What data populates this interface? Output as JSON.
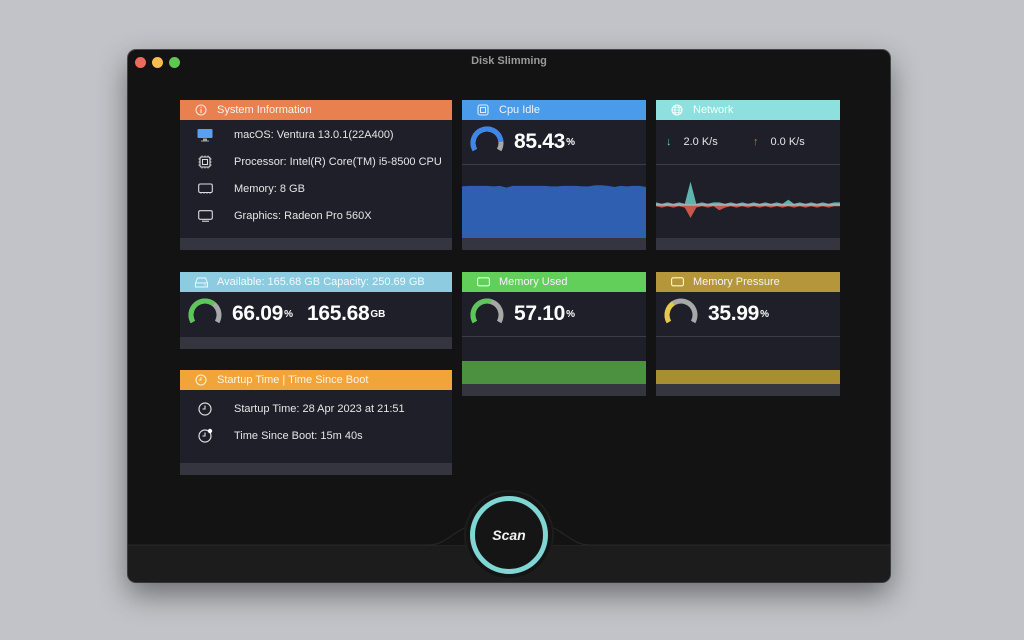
{
  "window": {
    "title": "Disk Slimming"
  },
  "colors": {
    "system_info": "#e8814f",
    "cpu": "#4a9bea",
    "network": "#8de0dd",
    "disk": "#8ccbe0",
    "memory_used": "#62cf5b",
    "memory_pressure": "#b5963a",
    "startup": "#f0a43a",
    "scan_ring": "#7fd6d3"
  },
  "system_info": {
    "title": "System Information",
    "header_icon": "info-icon",
    "rows": [
      {
        "icon": "monitor-icon",
        "text": "macOS: Ventura 13.0.1(22A400)"
      },
      {
        "icon": "cpu-chip-icon",
        "text": "Processor: Intel(R) Core(TM) i5-8500 CPU"
      },
      {
        "icon": "memory-icon",
        "text": "Memory: 8 GB"
      },
      {
        "icon": "display-icon",
        "text": "Graphics: Radeon Pro 560X"
      }
    ]
  },
  "cpu": {
    "title": "Cpu Idle",
    "header_icon": "cpu-chip-icon",
    "value": "85.43",
    "unit": "%",
    "gauge_fraction": 0.8543,
    "history_percent": [
      84,
      85,
      85,
      85,
      85,
      84,
      85,
      82,
      85,
      85,
      85,
      85,
      85,
      85,
      84,
      84,
      85,
      85,
      85,
      84,
      84,
      86,
      86,
      85,
      83,
      85,
      84,
      85,
      85,
      83
    ]
  },
  "network": {
    "title": "Network",
    "header_icon": "globe-icon",
    "download": "2.0 K/s",
    "upload": "0.0 K/s",
    "download_history": [
      1,
      0.5,
      1,
      0.5,
      1,
      0.5,
      9,
      0.5,
      1,
      0.5,
      1,
      1,
      0.5,
      1,
      0.5,
      1,
      0.5,
      1,
      0.5,
      1,
      0.5,
      1,
      0.5,
      2,
      0.5,
      1,
      0.5,
      1,
      0.5,
      1,
      0.5,
      1,
      1
    ],
    "upload_history": [
      0.5,
      1,
      0.5,
      1,
      0.5,
      1,
      5,
      1,
      0.5,
      1,
      0.5,
      2,
      1,
      0.5,
      1,
      0.5,
      1,
      0.5,
      1,
      0.5,
      1,
      0.5,
      1,
      0.5,
      1,
      0.5,
      1,
      0.5,
      1,
      0.5,
      1,
      0.5,
      0.5
    ]
  },
  "disk": {
    "title": "Available: 165.68 GB  Capacity: 250.69 GB",
    "header_icon": "drive-icon",
    "percent": "66.09",
    "percent_unit": "%",
    "available": "165.68",
    "available_unit": "GB",
    "gauge_fraction": 0.6609
  },
  "memory_used": {
    "title": "Memory Used",
    "header_icon": "memory-icon",
    "value": "57.10",
    "unit": "%",
    "gauge_fraction": 0.571,
    "history_percent": 57.1
  },
  "memory_pressure": {
    "title": "Memory Pressure",
    "header_icon": "memory-icon",
    "value": "35.99",
    "unit": "%",
    "gauge_fraction": 0.3599,
    "history_percent": 35.99
  },
  "startup": {
    "title": "Startup Time | Time Since Boot",
    "header_icon": "clock-icon",
    "rows": [
      {
        "icon": "clock-icon",
        "text": "Startup Time: 28 Apr 2023 at 21:51"
      },
      {
        "icon": "clock-badge-icon",
        "text": "Time Since Boot: 15m 40s"
      }
    ]
  },
  "scan": {
    "label": "Scan"
  }
}
